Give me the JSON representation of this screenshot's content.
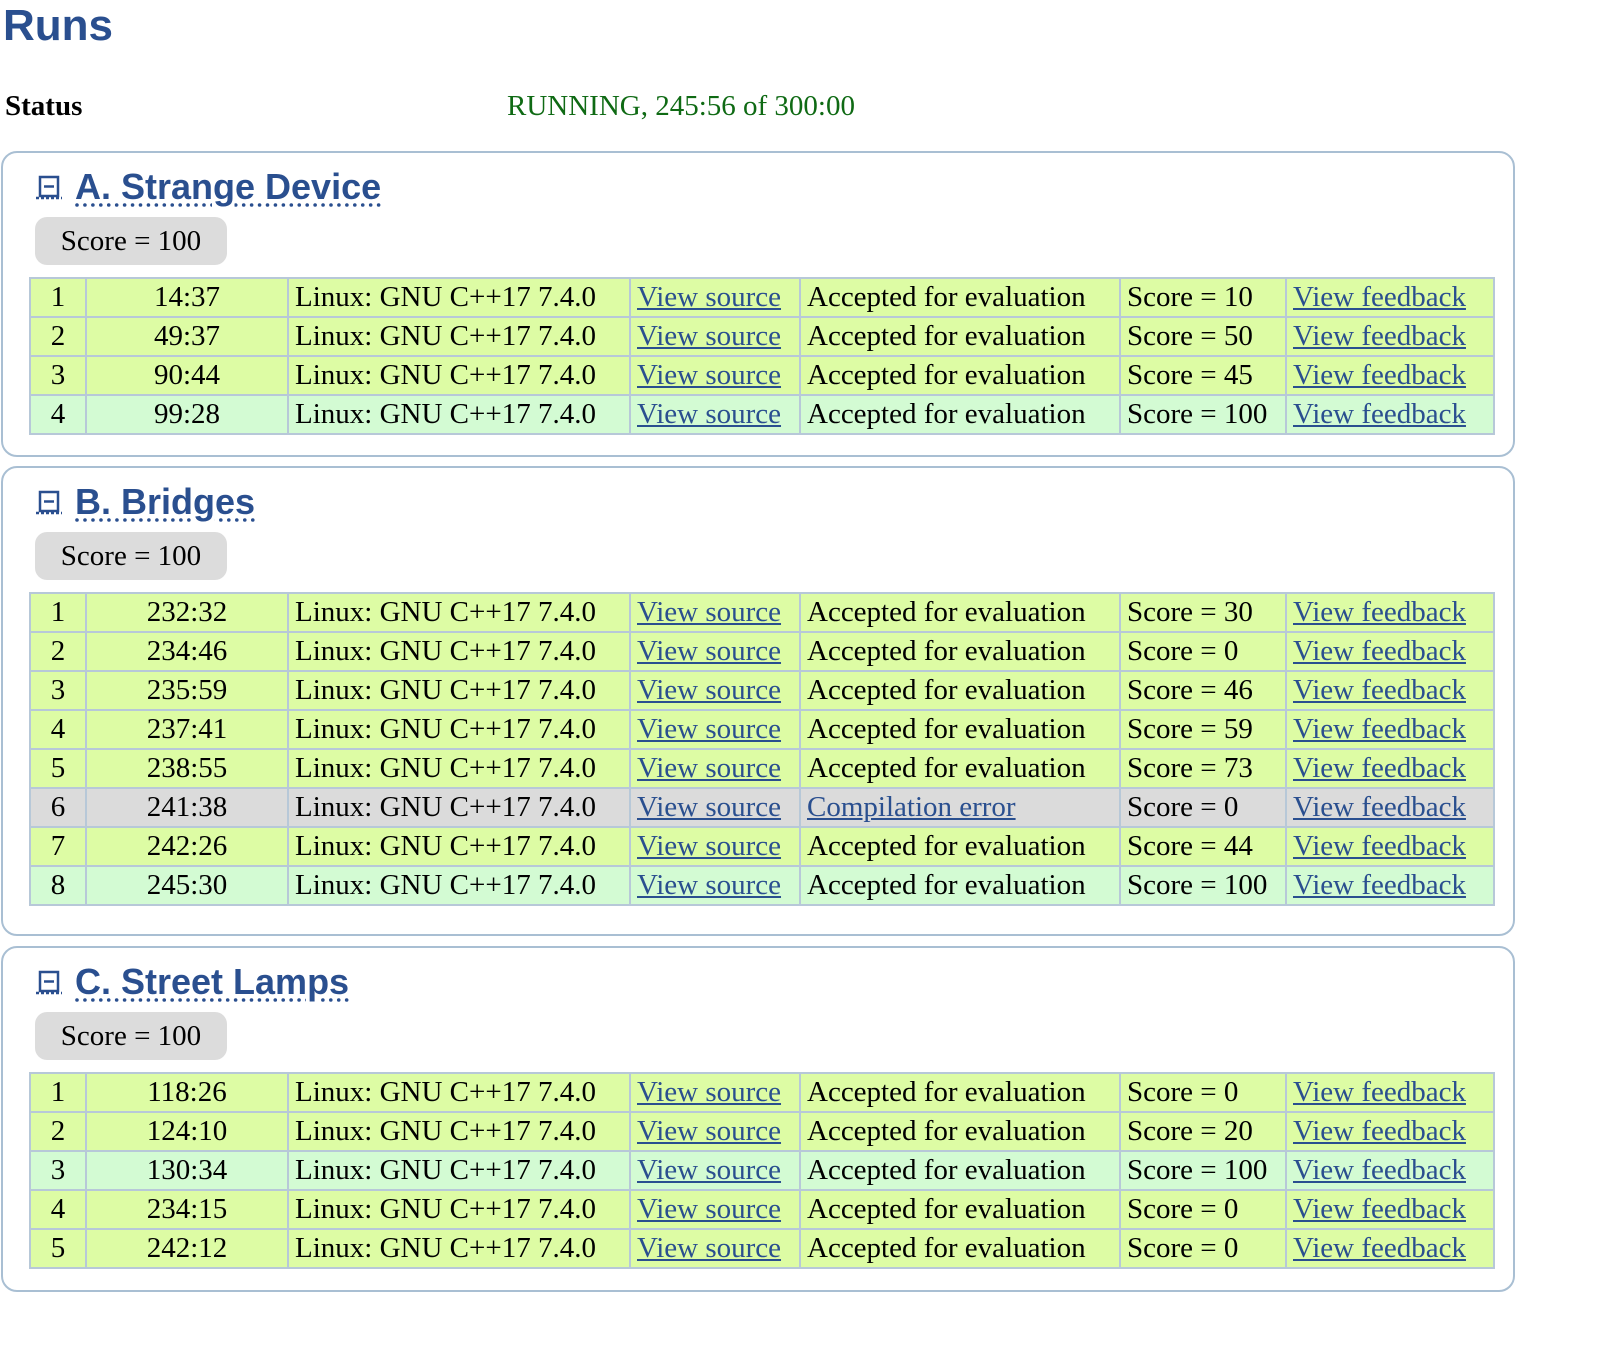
{
  "page": {
    "title": "Runs"
  },
  "status": {
    "label": "Status",
    "value": "RUNNING, 245:56 of 300:00"
  },
  "problems": [
    {
      "title": "A. Strange Device",
      "score": "Score = 100",
      "runs": [
        {
          "num": "1",
          "time": "14:37",
          "lang": "Linux: GNU C++17 7.4.0",
          "source": "View source",
          "status": "Accepted for evaluation",
          "status_link": false,
          "score": "Score = 10",
          "feedback": "View feedback",
          "kind": "ok"
        },
        {
          "num": "2",
          "time": "49:37",
          "lang": "Linux: GNU C++17 7.4.0",
          "source": "View source",
          "status": "Accepted for evaluation",
          "status_link": false,
          "score": "Score = 50",
          "feedback": "View feedback",
          "kind": "ok"
        },
        {
          "num": "3",
          "time": "90:44",
          "lang": "Linux: GNU C++17 7.4.0",
          "source": "View source",
          "status": "Accepted for evaluation",
          "status_link": false,
          "score": "Score = 45",
          "feedback": "View feedback",
          "kind": "ok"
        },
        {
          "num": "4",
          "time": "99:28",
          "lang": "Linux: GNU C++17 7.4.0",
          "source": "View source",
          "status": "Accepted for evaluation",
          "status_link": false,
          "score": "Score = 100",
          "feedback": "View feedback",
          "kind": "full"
        }
      ]
    },
    {
      "title": "B. Bridges",
      "score": "Score = 100",
      "runs": [
        {
          "num": "1",
          "time": "232:32",
          "lang": "Linux: GNU C++17 7.4.0",
          "source": "View source",
          "status": "Accepted for evaluation",
          "status_link": false,
          "score": "Score = 30",
          "feedback": "View feedback",
          "kind": "ok"
        },
        {
          "num": "2",
          "time": "234:46",
          "lang": "Linux: GNU C++17 7.4.0",
          "source": "View source",
          "status": "Accepted for evaluation",
          "status_link": false,
          "score": "Score = 0",
          "feedback": "View feedback",
          "kind": "ok"
        },
        {
          "num": "3",
          "time": "235:59",
          "lang": "Linux: GNU C++17 7.4.0",
          "source": "View source",
          "status": "Accepted for evaluation",
          "status_link": false,
          "score": "Score = 46",
          "feedback": "View feedback",
          "kind": "ok"
        },
        {
          "num": "4",
          "time": "237:41",
          "lang": "Linux: GNU C++17 7.4.0",
          "source": "View source",
          "status": "Accepted for evaluation",
          "status_link": false,
          "score": "Score = 59",
          "feedback": "View feedback",
          "kind": "ok"
        },
        {
          "num": "5",
          "time": "238:55",
          "lang": "Linux: GNU C++17 7.4.0",
          "source": "View source",
          "status": "Accepted for evaluation",
          "status_link": false,
          "score": "Score = 73",
          "feedback": "View feedback",
          "kind": "ok"
        },
        {
          "num": "6",
          "time": "241:38",
          "lang": "Linux: GNU C++17 7.4.0",
          "source": "View source",
          "status": "Compilation error",
          "status_link": true,
          "score": "Score = 0",
          "feedback": "View feedback",
          "kind": "err"
        },
        {
          "num": "7",
          "time": "242:26",
          "lang": "Linux: GNU C++17 7.4.0",
          "source": "View source",
          "status": "Accepted for evaluation",
          "status_link": false,
          "score": "Score = 44",
          "feedback": "View feedback",
          "kind": "ok"
        },
        {
          "num": "8",
          "time": "245:30",
          "lang": "Linux: GNU C++17 7.4.0",
          "source": "View source",
          "status": "Accepted for evaluation",
          "status_link": false,
          "score": "Score = 100",
          "feedback": "View feedback",
          "kind": "full"
        }
      ]
    },
    {
      "title": "C. Street Lamps",
      "score": "Score = 100",
      "runs": [
        {
          "num": "1",
          "time": "118:26",
          "lang": "Linux: GNU C++17 7.4.0",
          "source": "View source",
          "status": "Accepted for evaluation",
          "status_link": false,
          "score": "Score = 0",
          "feedback": "View feedback",
          "kind": "ok"
        },
        {
          "num": "2",
          "time": "124:10",
          "lang": "Linux: GNU C++17 7.4.0",
          "source": "View source",
          "status": "Accepted for evaluation",
          "status_link": false,
          "score": "Score = 20",
          "feedback": "View feedback",
          "kind": "ok"
        },
        {
          "num": "3",
          "time": "130:34",
          "lang": "Linux: GNU C++17 7.4.0",
          "source": "View source",
          "status": "Accepted for evaluation",
          "status_link": false,
          "score": "Score = 100",
          "feedback": "View feedback",
          "kind": "full"
        },
        {
          "num": "4",
          "time": "234:15",
          "lang": "Linux: GNU C++17 7.4.0",
          "source": "View source",
          "status": "Accepted for evaluation",
          "status_link": false,
          "score": "Score = 0",
          "feedback": "View feedback",
          "kind": "ok"
        },
        {
          "num": "5",
          "time": "242:12",
          "lang": "Linux: GNU C++17 7.4.0",
          "source": "View source",
          "status": "Accepted for evaluation",
          "status_link": false,
          "score": "Score = 0",
          "feedback": "View feedback",
          "kind": "ok"
        }
      ]
    }
  ]
}
